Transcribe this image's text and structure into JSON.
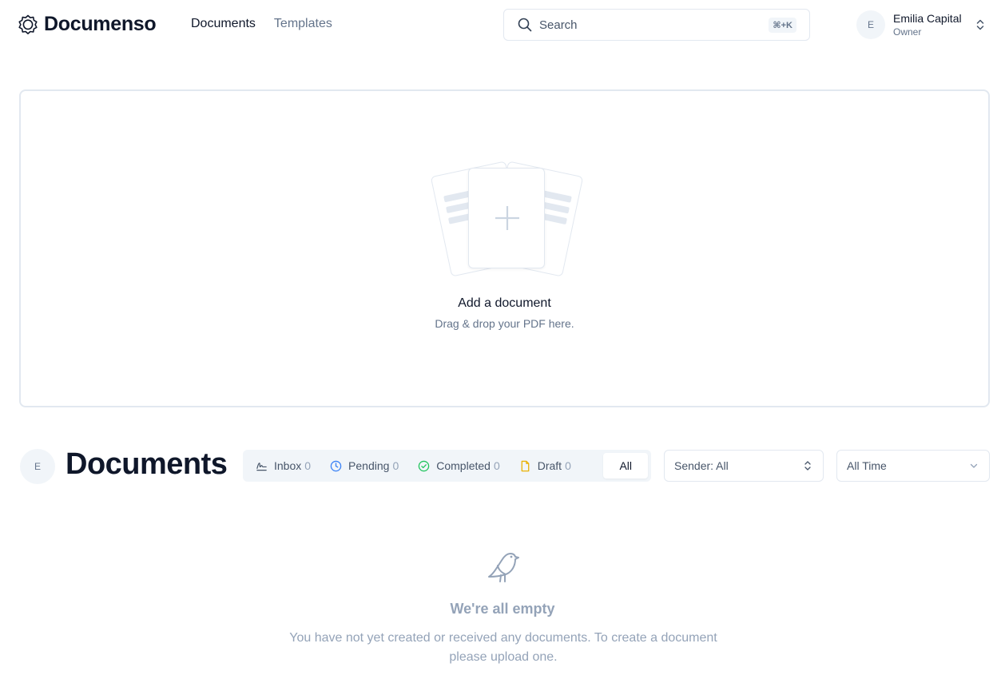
{
  "header": {
    "app_name": "Documenso",
    "nav": [
      {
        "label": "Documents",
        "active": true
      },
      {
        "label": "Templates",
        "active": false
      }
    ],
    "search": {
      "label": "Search",
      "shortcut": "⌘+K"
    },
    "account": {
      "initial": "E",
      "name": "Emilia Capital",
      "role": "Owner"
    }
  },
  "upload": {
    "title": "Add a document",
    "subtitle": "Drag & drop your PDF here.",
    "accent_color": "#a2e771"
  },
  "documents": {
    "avatar_initial": "E",
    "title": "Documents",
    "tabs": [
      {
        "label": "Inbox",
        "count": "0",
        "icon": "signature-icon"
      },
      {
        "label": "Pending",
        "count": "0",
        "icon": "clock-icon"
      },
      {
        "label": "Completed",
        "count": "0",
        "icon": "check-circle-icon"
      },
      {
        "label": "Draft",
        "count": "0",
        "icon": "file-icon"
      },
      {
        "label": "All",
        "active": true
      }
    ],
    "sender_filter": "Sender: All",
    "time_filter": "All Time"
  },
  "empty_state": {
    "icon": "bird-icon",
    "title": "We're all empty",
    "text": "You have not yet created or received any documents. To create a document please upload one."
  },
  "colors": {
    "pending": "#3b82f6",
    "completed": "#22c55e",
    "draft": "#eab308"
  }
}
